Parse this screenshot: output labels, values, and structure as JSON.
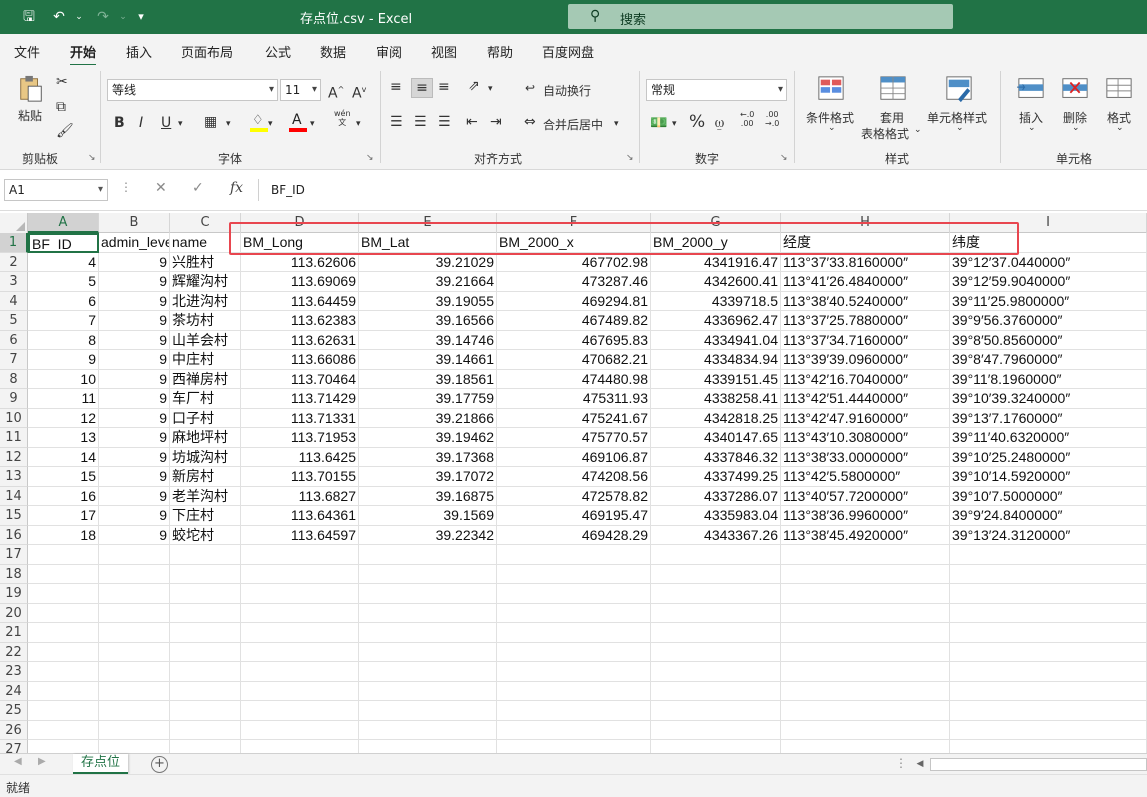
{
  "window": {
    "title": "存点位.csv  -  Excel",
    "search_placeholder": "搜索"
  },
  "menu": [
    "文件",
    "开始",
    "插入",
    "页面布局",
    "公式",
    "数据",
    "审阅",
    "视图",
    "帮助",
    "百度网盘"
  ],
  "menu_active": "开始",
  "ribbon": {
    "clipboard": {
      "paste_label": "粘贴",
      "group_label": "剪贴板"
    },
    "font": {
      "font_name": "等线",
      "font_size": "11",
      "group_label": "字体",
      "phonetic_label": "wén"
    },
    "alignment": {
      "wrap_text": "自动换行",
      "merge_center": "合并后居中",
      "group_label": "对齐方式"
    },
    "number": {
      "format": "常规",
      "group_label": "数字"
    },
    "styles": {
      "conditional": "条件格式",
      "table_line1": "套用",
      "table_line2": "表格格式",
      "cell_styles": "单元格样式",
      "group_label": "样式"
    },
    "cells": {
      "insert": "插入",
      "delete": "删除",
      "format": "格式",
      "group_label": "单元格"
    }
  },
  "formula_bar": {
    "name_box": "A1",
    "fx_label": "fx",
    "content": "BF_ID"
  },
  "columns": [
    {
      "letter": "A"
    },
    {
      "letter": "B"
    },
    {
      "letter": "C"
    },
    {
      "letter": "D"
    },
    {
      "letter": "E"
    },
    {
      "letter": "F"
    },
    {
      "letter": "G"
    },
    {
      "letter": "H"
    },
    {
      "letter": "I"
    }
  ],
  "header_row": [
    "BF_ID",
    "admin_level",
    "name",
    "BM_Long",
    "BM_Lat",
    "BM_2000_x",
    "BM_2000_y",
    "经度",
    "纬度"
  ],
  "rows": [
    [
      "4",
      "9",
      "兴胜村",
      "113.62606",
      "39.21029",
      "467702.98",
      "4341916.47",
      "113°37′33.8160000″",
      "39°12′37.0440000″"
    ],
    [
      "5",
      "9",
      "辉耀沟村",
      "113.69069",
      "39.21664",
      "473287.46",
      "4342600.41",
      "113°41′26.4840000″",
      "39°12′59.9040000″"
    ],
    [
      "6",
      "9",
      "北进沟村",
      "113.64459",
      "39.19055",
      "469294.81",
      "4339718.5",
      "113°38′40.5240000″",
      "39°11′25.9800000″"
    ],
    [
      "7",
      "9",
      "茶坊村",
      "113.62383",
      "39.16566",
      "467489.82",
      "4336962.47",
      "113°37′25.7880000″",
      "39°9′56.3760000″"
    ],
    [
      "8",
      "9",
      "山羊会村",
      "113.62631",
      "39.14746",
      "467695.83",
      "4334941.04",
      "113°37′34.7160000″",
      "39°8′50.8560000″"
    ],
    [
      "9",
      "9",
      "中庄村",
      "113.66086",
      "39.14661",
      "470682.21",
      "4334834.94",
      "113°39′39.0960000″",
      "39°8′47.7960000″"
    ],
    [
      "10",
      "9",
      "西禅房村",
      "113.70464",
      "39.18561",
      "474480.98",
      "4339151.45",
      "113°42′16.7040000″",
      "39°11′8.1960000″"
    ],
    [
      "11",
      "9",
      "车厂村",
      "113.71429",
      "39.17759",
      "475311.93",
      "4338258.41",
      "113°42′51.4440000″",
      "39°10′39.3240000″"
    ],
    [
      "12",
      "9",
      "口子村",
      "113.71331",
      "39.21866",
      "475241.67",
      "4342818.25",
      "113°42′47.9160000″",
      "39°13′7.1760000″"
    ],
    [
      "13",
      "9",
      "麻地坪村",
      "113.71953",
      "39.19462",
      "475770.57",
      "4340147.65",
      "113°43′10.3080000″",
      "39°11′40.6320000″"
    ],
    [
      "14",
      "9",
      "坊城沟村",
      "113.6425",
      "39.17368",
      "469106.87",
      "4337846.32",
      "113°38′33.0000000″",
      "39°10′25.2480000″"
    ],
    [
      "15",
      "9",
      "新房村",
      "113.70155",
      "39.17072",
      "474208.56",
      "4337499.25",
      "113°42′5.5800000″",
      "39°10′14.5920000″"
    ],
    [
      "16",
      "9",
      "老羊沟村",
      "113.6827",
      "39.16875",
      "472578.82",
      "4337286.07",
      "113°40′57.7200000″",
      "39°10′7.5000000″"
    ],
    [
      "17",
      "9",
      "下庄村",
      "113.64361",
      "39.1569",
      "469195.47",
      "4335983.04",
      "113°38′36.9960000″",
      "39°9′24.8400000″"
    ],
    [
      "18",
      "9",
      "蛟坨村",
      "113.64597",
      "39.22342",
      "469428.29",
      "4343367.26",
      "113°38′45.4920000″",
      "39°13′24.3120000″"
    ]
  ],
  "row_numbers": [
    "1",
    "2",
    "3",
    "4",
    "5",
    "6",
    "7",
    "8",
    "9",
    "10",
    "11",
    "12",
    "13",
    "14",
    "15",
    "16",
    "17",
    "18",
    "19",
    "20",
    "21",
    "22",
    "23",
    "24",
    "25",
    "26",
    "27"
  ],
  "sheet_tab": "存点位",
  "status": "就绪",
  "colors": {
    "accent": "#217346",
    "highlight": "#e8464f"
  }
}
